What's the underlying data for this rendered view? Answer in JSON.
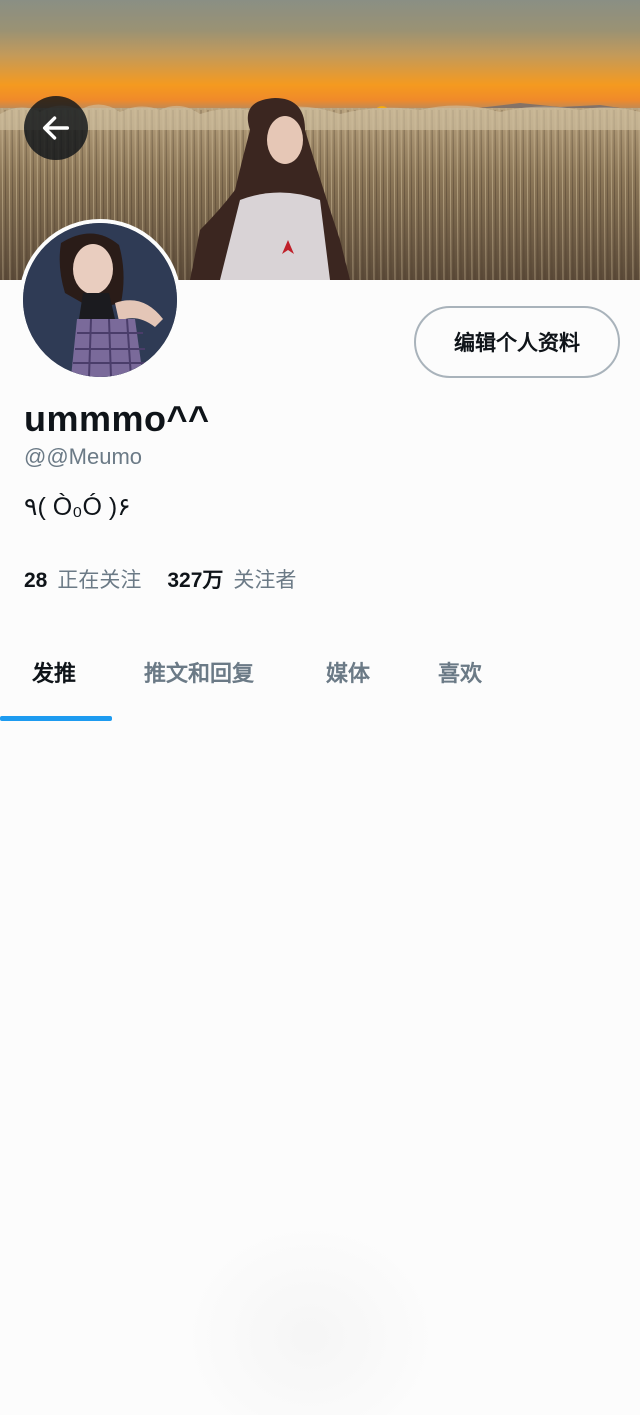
{
  "header": {
    "back_icon": "arrow-left-icon",
    "banner_description_colors": {
      "sky": "#f59a1f",
      "grass": "#6f604c"
    }
  },
  "profile": {
    "display_name": "ummmo^^",
    "handle": "@@Meumo",
    "bio": "٩( Ò₀Ó )۶",
    "edit_button_label": "编辑个人资料"
  },
  "stats": {
    "following_count": "28",
    "following_label": "正在关注",
    "followers_count": "327万",
    "followers_label": "关注者"
  },
  "tabs": [
    {
      "label": "发推",
      "active": true
    },
    {
      "label": "推文和回复",
      "active": false
    },
    {
      "label": "媒体",
      "active": false
    },
    {
      "label": "喜欢",
      "active": false
    }
  ],
  "colors": {
    "accent": "#1d9bf0",
    "primary_text": "#0f1419",
    "secondary_text": "#6b7a86",
    "border": "#a9b3bb"
  }
}
